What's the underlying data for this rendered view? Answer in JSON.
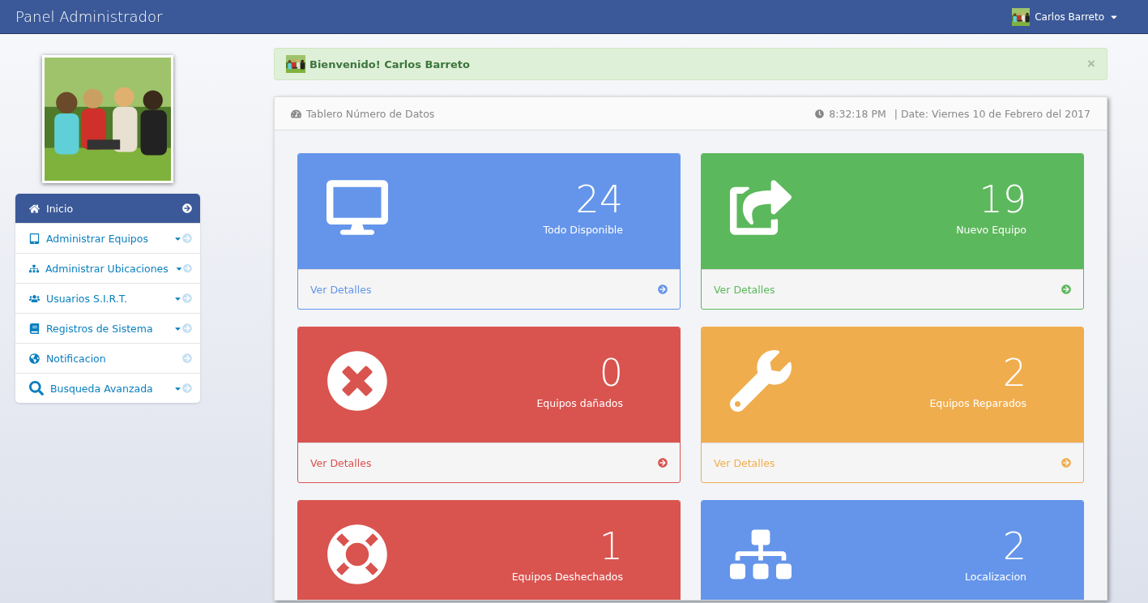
{
  "navbar": {
    "title": "Panel Administrador",
    "user": "Carlos Barreto"
  },
  "sidebar": {
    "items": [
      {
        "label": "Inicio",
        "selected": true,
        "dropdown": false
      },
      {
        "label": "Administrar Equipos",
        "selected": false,
        "dropdown": true
      },
      {
        "label": "Administrar Ubicaciones",
        "selected": false,
        "dropdown": true
      },
      {
        "label": "Usuarios S.I.R.T.",
        "selected": false,
        "dropdown": true
      },
      {
        "label": "Registros de Sistema",
        "selected": false,
        "dropdown": true
      },
      {
        "label": "Notificacion",
        "selected": false,
        "dropdown": false
      },
      {
        "label": "Busqueda Avanzada",
        "selected": false,
        "dropdown": true
      }
    ]
  },
  "alert": {
    "message": "Bienvenido! Carlos Barreto",
    "close": "×"
  },
  "panel": {
    "title": "Tablero Número de Datos",
    "time": "8:32:18 PM",
    "date": "| Date: Viernes 10 de Febrero del 2017",
    "cards": [
      {
        "count": "24",
        "label": "Todo Disponible",
        "link": "Ver Detalles",
        "color": "#6495ea"
      },
      {
        "count": "19",
        "label": "Nuevo Equipo",
        "link": "Ver Detalles",
        "color": "#5cb85c"
      },
      {
        "count": "0",
        "label": "Equipos dañados",
        "link": "Ver Detalles",
        "color": "#d9534f"
      },
      {
        "count": "2",
        "label": "Equipos Reparados",
        "link": "Ver Detalles",
        "color": "#f0ad4e"
      },
      {
        "count": "1",
        "label": "Equipos Deshechados",
        "color": "#d9534f"
      },
      {
        "count": "2",
        "label": "Localizacion",
        "color": "#6495ea"
      }
    ]
  }
}
